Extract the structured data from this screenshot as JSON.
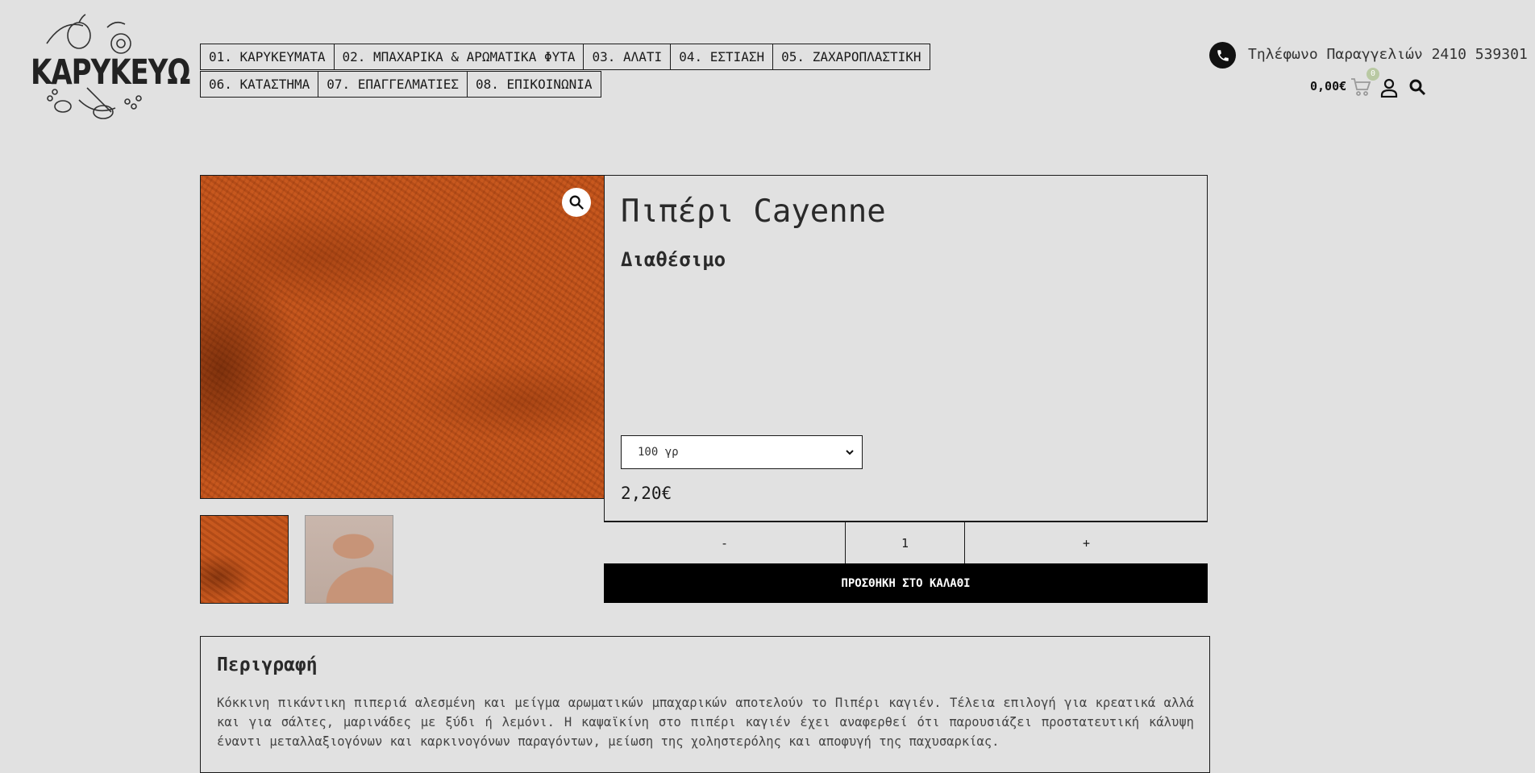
{
  "brand": {
    "logo_text": "ΚΑΡΥΚΕΥΩ"
  },
  "nav": {
    "row1": [
      "01. ΚΑΡΥΚΕΥΜΑΤΑ",
      "02. ΜΠΑΧΑΡΙΚΑ & ΑΡΩΜΑΤΙΚΑ ΦΥΤΑ",
      "03. ΑΛΑΤΙ",
      "04. ΕΣΤΙΑΣΗ",
      "05. ΖΑΧΑΡΟΠΛΑΣΤΙΚΗ"
    ],
    "row2": [
      "06. ΚΑΤΑΣΤΗΜΑ",
      "07. ΕΠΑΓΓΕΛΜΑΤΙΕΣ",
      "08. ΕΠΙΚΟΙΝΩΝΙΑ"
    ]
  },
  "header": {
    "phone_text": "Τηλέφωνο Παραγγελιών 2410 539301",
    "cart_total": "0,00€",
    "cart_count": "0",
    "icons": [
      "phone-icon",
      "cart-icon",
      "user-icon",
      "search-icon"
    ]
  },
  "product": {
    "title": "Πιπέρι Cayenne",
    "stock": "Διαθέσιμο",
    "variant_selected": "100 γρ",
    "price": "2,20€",
    "qty_minus": "-",
    "qty_value": "1",
    "qty_plus": "+",
    "add_to_cart": "ΠΡΟΣΘΗΚΗ ΣΤΟ ΚΑΛΑΘΙ",
    "zoom_icon": "magnifier-icon"
  },
  "description": {
    "title": "Περιγραφή",
    "text": "Κόκκινη πικάντικη πιπεριά αλεσμένη και μείγμα αρωματικών μπαχαρικών αποτελούν το Πιπέρι καγιέν. Τέλεια επιλογή για κρεατικά αλλά και για σάλτες, μαρινάδες με ξύδι ή λεμόνι. Η καψαϊκίνη στο πιπέρι καγιέν έχει αναφερθεί ότι παρουσιάζει προστατευτική κάλυψη έναντι μεταλλαξιογόνων και καρκινογόνων παραγόντων, μείωση της χοληστερόλης και αποφυγή της παχυσαρκίας."
  },
  "colors": {
    "background": "#e1e1e1",
    "cayenne": "#c2531b",
    "button_black": "#000000",
    "badge_green": "#b9c9a3"
  }
}
